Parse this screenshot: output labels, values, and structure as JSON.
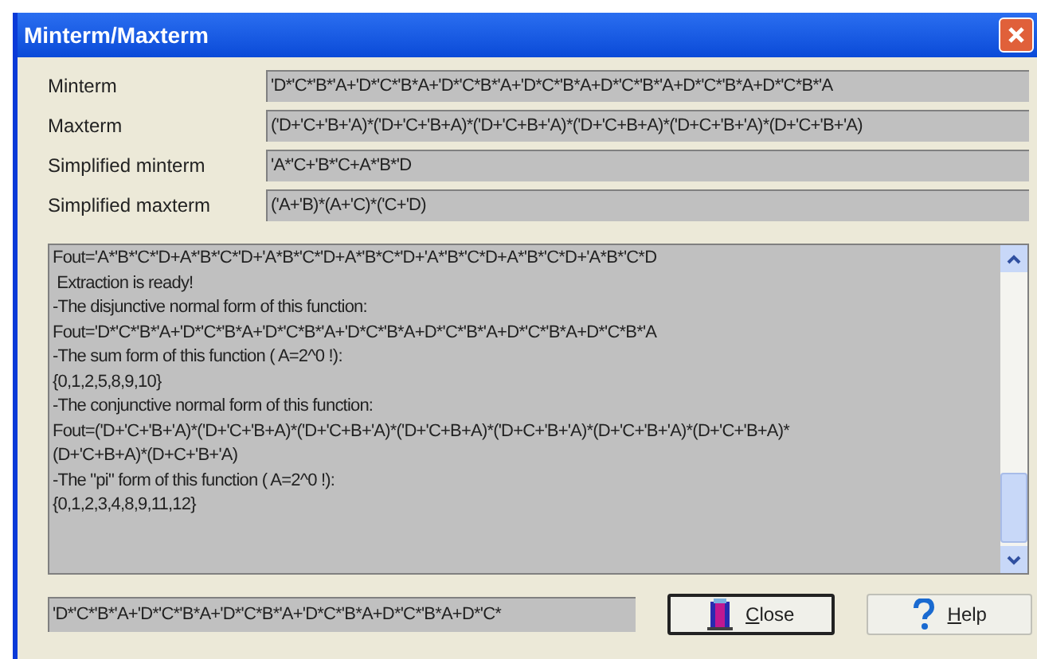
{
  "window": {
    "title": "Minterm/Maxterm"
  },
  "fields": [
    {
      "label": "Minterm",
      "value": "'D*'C*'B*'A+'D*'C*'B*A+'D*'C*B*'A+'D*C*'B*A+D*'C*'B*'A+D*'C*'B*A+D*'C*B*'A"
    },
    {
      "label": "Maxterm",
      "value": "('D+'C+'B+'A)*('D+'C+'B+A)*('D+'C+B+'A)*('D+'C+B+A)*('D+C+'B+'A)*(D+'C+'B+'A)"
    },
    {
      "label": "Simplified minterm",
      "value": "'A*'C+'B*'C+A*'B*'D"
    },
    {
      "label": "Simplified maxterm",
      "value": "('A+'B)*(A+'C)*('C+'D)"
    }
  ],
  "output_lines": [
    "Fout='A*'B*'C*'D+A*'B*'C*'D+'A*B*'C*'D+A*'B*C*'D+'A*'B*'C*D+A*'B*'C*D+'A*B*'C*D",
    " Extraction is ready!",
    "-The disjunctive normal form of this function:",
    "Fout='D*'C*'B*'A+'D*'C*'B*A+'D*'C*B*'A+'D*C*'B*A+D*'C*'B*'A+D*'C*'B*A+D*'C*B*'A",
    "-The sum form of this function ( A=2^0 !):",
    "{0,1,2,5,8,9,10}",
    "-The conjunctive normal form of this function:",
    "Fout=('D+'C+'B+'A)*('D+'C+'B+A)*('D+'C+B+'A)*('D+'C+B+A)*('D+C+'B+'A)*(D+'C+'B+'A)*(D+'C+'B+A)*",
    "(D+'C+B+A)*(D+C+'B+'A)",
    "-The \"pi\" form of this function ( A=2^0 !):",
    "{0,1,2,3,4,8,9,11,12}"
  ],
  "result_field": {
    "value": "'D*'C*'B*'A+'D*'C*'B*A+'D*'C*B*'A+'D*C*'B*A+D*'C*'B*A+D*'C*"
  },
  "buttons": [
    {
      "kind": "close",
      "label": "Close"
    },
    {
      "kind": "help",
      "label": "Help"
    }
  ]
}
